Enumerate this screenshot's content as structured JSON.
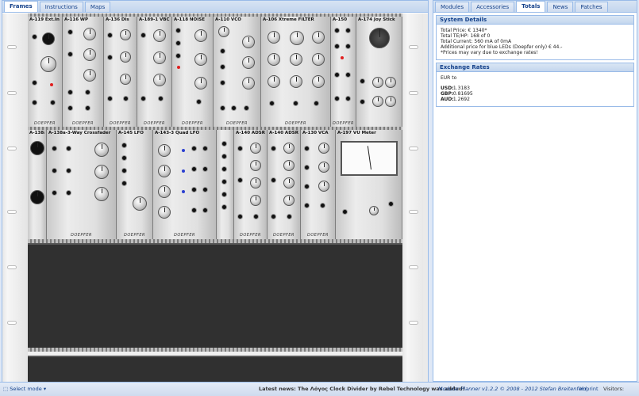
{
  "left_tabs": [
    "Frames",
    "Instructions",
    "Maps"
  ],
  "right_tabs": [
    "Modules",
    "Accessories",
    "Totals",
    "News",
    "Patches"
  ],
  "brand": "DOEPFER",
  "row1_modules": [
    "A-119 Ext.In",
    "A-116 WP",
    "A-136 Dis",
    "A-189-1 VBC",
    "A-118 NOISE",
    "A-110 VCO",
    "A-106 Xtreme FILTER",
    "A-150",
    "A-174 Joy Stick"
  ],
  "row2_modules": [
    "A-138a",
    "A-138a-3-Way Crossfader",
    "A-145 LFO",
    "A-143-3 Quad LFO",
    "",
    "A-140 ADSR",
    "A-140 ADSR",
    "A-130 VCA",
    "A-197 VU Meter"
  ],
  "system_details": {
    "title": "System Details",
    "lines": [
      "Total Price: € 1340*",
      "Total TE/HP: 168 of 0",
      "Total Current: 560 mA of 0mA",
      "Additional price for blue LEDs (Doepfer only) € 44.-",
      "*Prices may vary due to exchange rates!"
    ]
  },
  "exchange_rates": {
    "title": "Exchange Rates",
    "base": "EUR to",
    "rates": [
      {
        "code": "USD:",
        "value": "1.3183"
      },
      {
        "code": "GBP:",
        "value": "0.81695"
      },
      {
        "code": "AUD:",
        "value": "1.2692"
      }
    ]
  },
  "status": {
    "select_mode": "Select mode",
    "news": "Latest news: The Λόγος Clock Divider by Rebel Technology was added!",
    "product": "Modular Planner v1.2.2 © 2008 - 2012 Stefan Breitenfeld",
    "imprint": "Imprint",
    "visitors": "Visitors: 74948"
  }
}
